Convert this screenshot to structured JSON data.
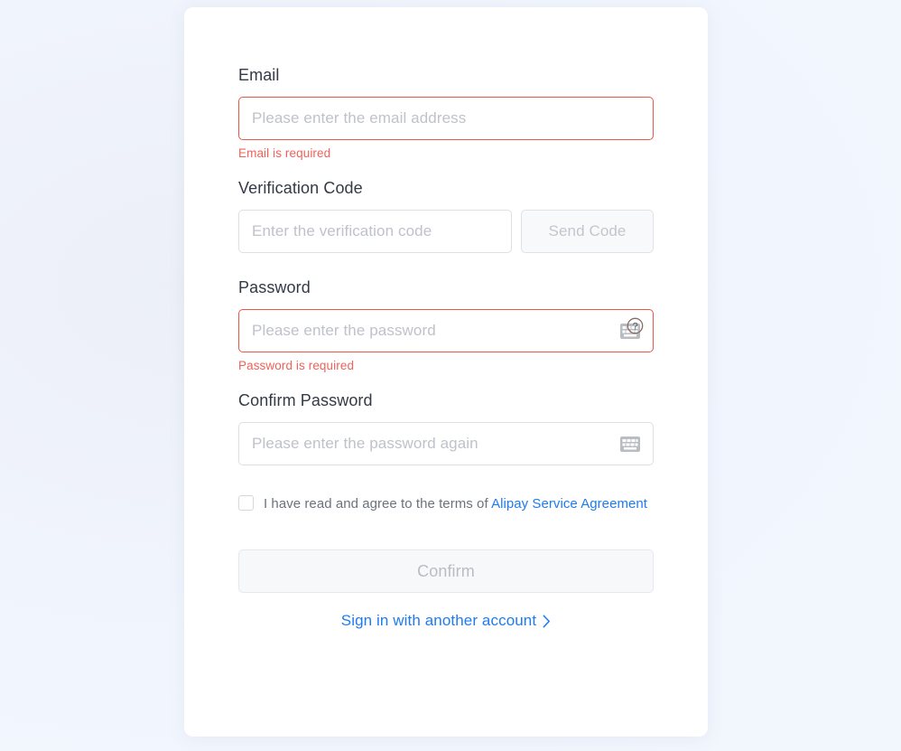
{
  "theme": {
    "page_background": "#f1f5fd",
    "card_background": "#ffffff",
    "label_color": "#333a45",
    "placeholder_color": "#bfc2c9",
    "error_color": "#f0615a",
    "error_border_color": "#e8564a",
    "link_color": "#1f7bf0",
    "disabled_text_color": "#c3c6cd"
  },
  "form": {
    "email": {
      "label": "Email",
      "placeholder": "Please enter the email address",
      "value": "",
      "error": "Email is required"
    },
    "verification_code": {
      "label": "Verification Code",
      "placeholder": "Enter the verification code",
      "value": "",
      "send_button_label": "Send Code"
    },
    "password": {
      "label": "Password",
      "placeholder": "Please enter the password",
      "value": "",
      "error": "Password is required",
      "keyboard_icon": "keyboard-icon",
      "help_icon": "question-circle-icon"
    },
    "confirm_password": {
      "label": "Confirm Password",
      "placeholder": "Please enter the password again",
      "value": "",
      "keyboard_icon": "keyboard-icon"
    },
    "agreement": {
      "checked": false,
      "text_prefix": "I have read and agree to the terms of ",
      "link_text": "Alipay Service Agreement"
    },
    "submit": {
      "label": "Confirm",
      "disabled": true
    },
    "alternate_signin": {
      "label": "Sign in with another account",
      "chevron": "chevron-right-icon"
    }
  }
}
